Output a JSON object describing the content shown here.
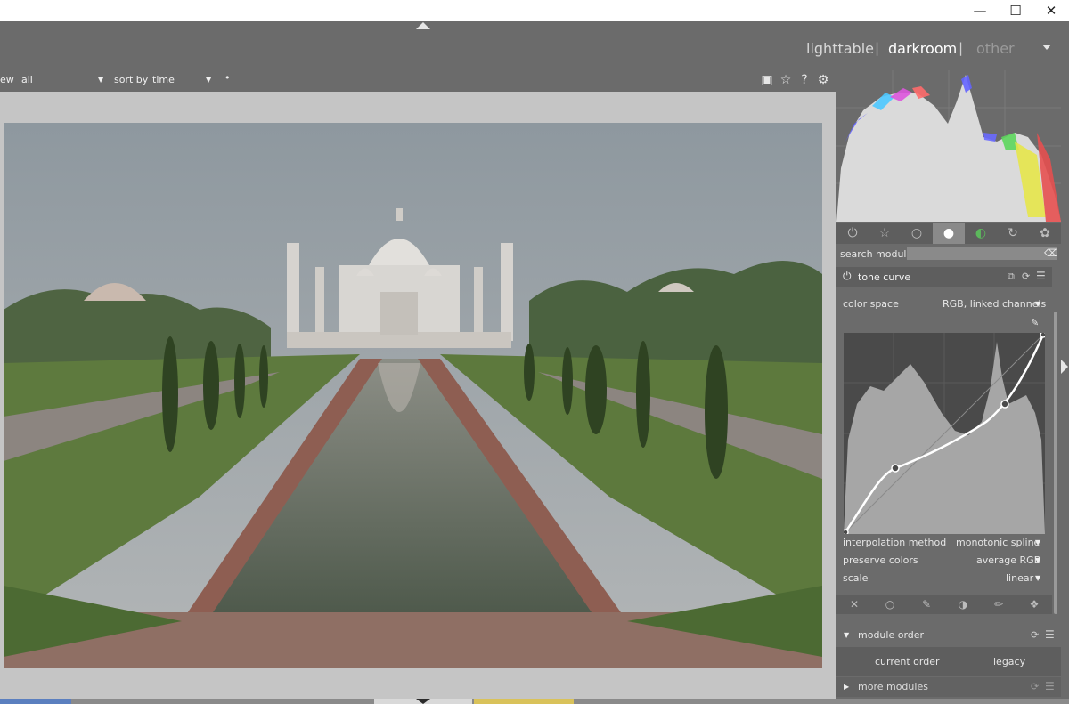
{
  "window": {
    "minimize_icon": "minimize-icon",
    "maximize_icon": "maximize-icon",
    "close_icon": "close-icon"
  },
  "header": {
    "views": [
      "lighttable",
      "darkroom",
      "other"
    ],
    "active_view": "darkroom",
    "separator": "|"
  },
  "toolbar": {
    "view_label": "ew",
    "view_value": "all",
    "sort_label": "sort by",
    "sort_value": "time",
    "sort_dir": "•",
    "icons": [
      "grouping-icon",
      "star-icon",
      "help-icon",
      "gear-icon"
    ]
  },
  "module_groups": [
    "power-icon",
    "star-icon",
    "circle-icon",
    "filled-circle-icon",
    "color-icon",
    "correct-icon",
    "effect-icon"
  ],
  "search": {
    "label": "search module",
    "placeholder": ""
  },
  "tone_curve": {
    "title": "tone curve",
    "color_space_label": "color space",
    "color_space_value": "RGB, linked channels",
    "interpolation_label": "interpolation method",
    "interpolation_value": "monotonic spline",
    "preserve_label": "preserve colors",
    "preserve_value": "average RGB",
    "scale_label": "scale",
    "scale_value": "linear"
  },
  "module_order": {
    "title": "module order",
    "current_label": "current order",
    "legacy_label": "legacy"
  },
  "more_modules": {
    "title": "more modules"
  },
  "colors": {
    "panel": "#6b6b6b",
    "center": "#c5c5c5",
    "header_dark": "#5e5e5e"
  }
}
